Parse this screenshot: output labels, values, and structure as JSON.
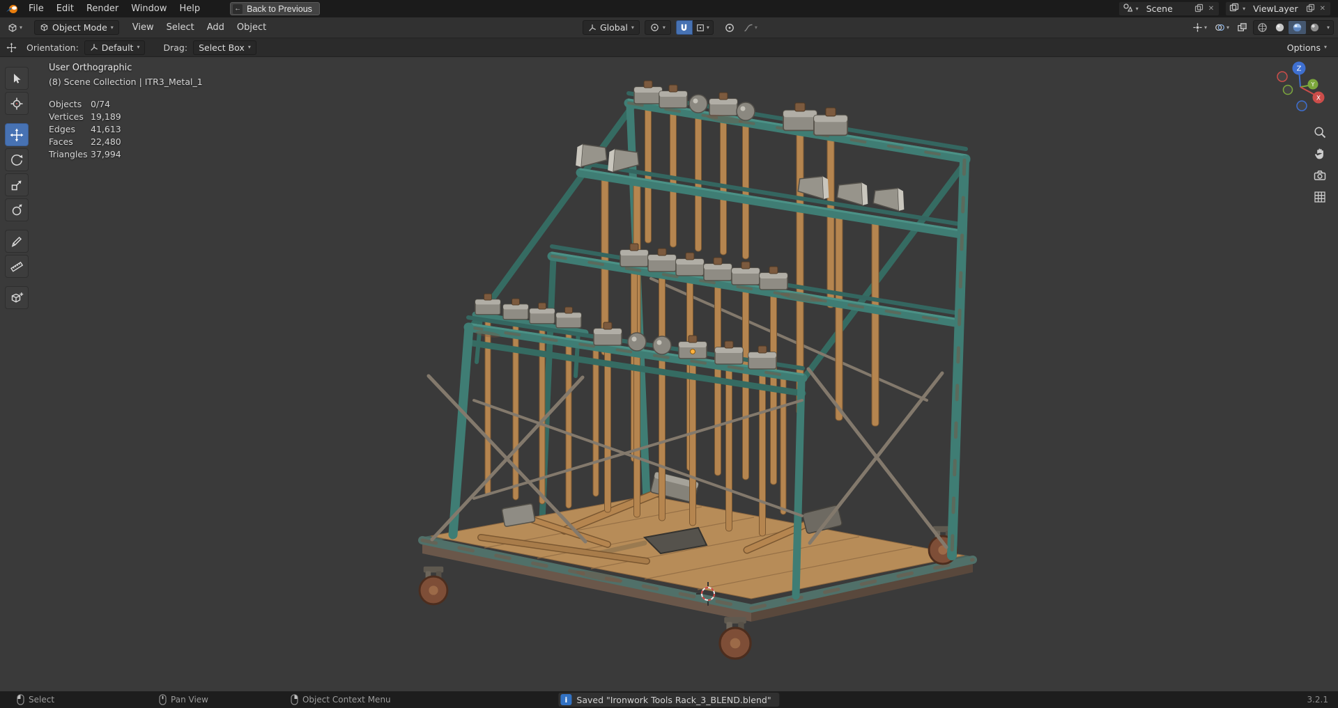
{
  "topbar": {
    "menus": [
      {
        "label": "File"
      },
      {
        "label": "Edit"
      },
      {
        "label": "Render"
      },
      {
        "label": "Window"
      },
      {
        "label": "Help"
      }
    ],
    "back_button_label": "Back to Previous",
    "scene_selector": {
      "value": "Scene"
    },
    "view_layer_selector": {
      "value": "ViewLayer"
    }
  },
  "viewport_header": {
    "mode_selector": "Object Mode",
    "menus": [
      {
        "label": "View"
      },
      {
        "label": "Select"
      },
      {
        "label": "Add"
      },
      {
        "label": "Object"
      }
    ],
    "transform_orientation": "Global"
  },
  "tool_settings": {
    "orientation_label": "Orientation:",
    "orientation_value": "Default",
    "drag_label": "Drag:",
    "drag_value": "Select Box",
    "options_label": "Options"
  },
  "viewport": {
    "view_label": "User Orthographic",
    "collection_label": "(8) Scene Collection | ITR3_Metal_1",
    "stats": [
      {
        "label": "Objects",
        "value": "0/74"
      },
      {
        "label": "Vertices",
        "value": "19,189"
      },
      {
        "label": "Edges",
        "value": "41,613"
      },
      {
        "label": "Faces",
        "value": "22,480"
      },
      {
        "label": "Triangles",
        "value": "37,994"
      }
    ],
    "gizmo": {
      "z": "Z",
      "x": "X",
      "y": "Y"
    }
  },
  "status_bar": {
    "hints": [
      {
        "label": "Select"
      },
      {
        "label": "Pan View"
      },
      {
        "label": "Object Context Menu"
      }
    ],
    "message": "Saved \"Ironwork Tools Rack_3_BLEND.blend\"",
    "version": "3.2.1"
  },
  "ui": {
    "chevron_down": "▾",
    "close": "✕"
  },
  "colors": {
    "accent_blue": "#4772b3",
    "axis_x_red": "#cc4d4a",
    "axis_y_green": "#7ca83c",
    "axis_z_blue": "#3e6fd0",
    "frame_teal": "#3f7d74",
    "wood_tan": "#b5854f",
    "metal_grey": "#8f8c84",
    "rust_brown": "#7d5440"
  }
}
